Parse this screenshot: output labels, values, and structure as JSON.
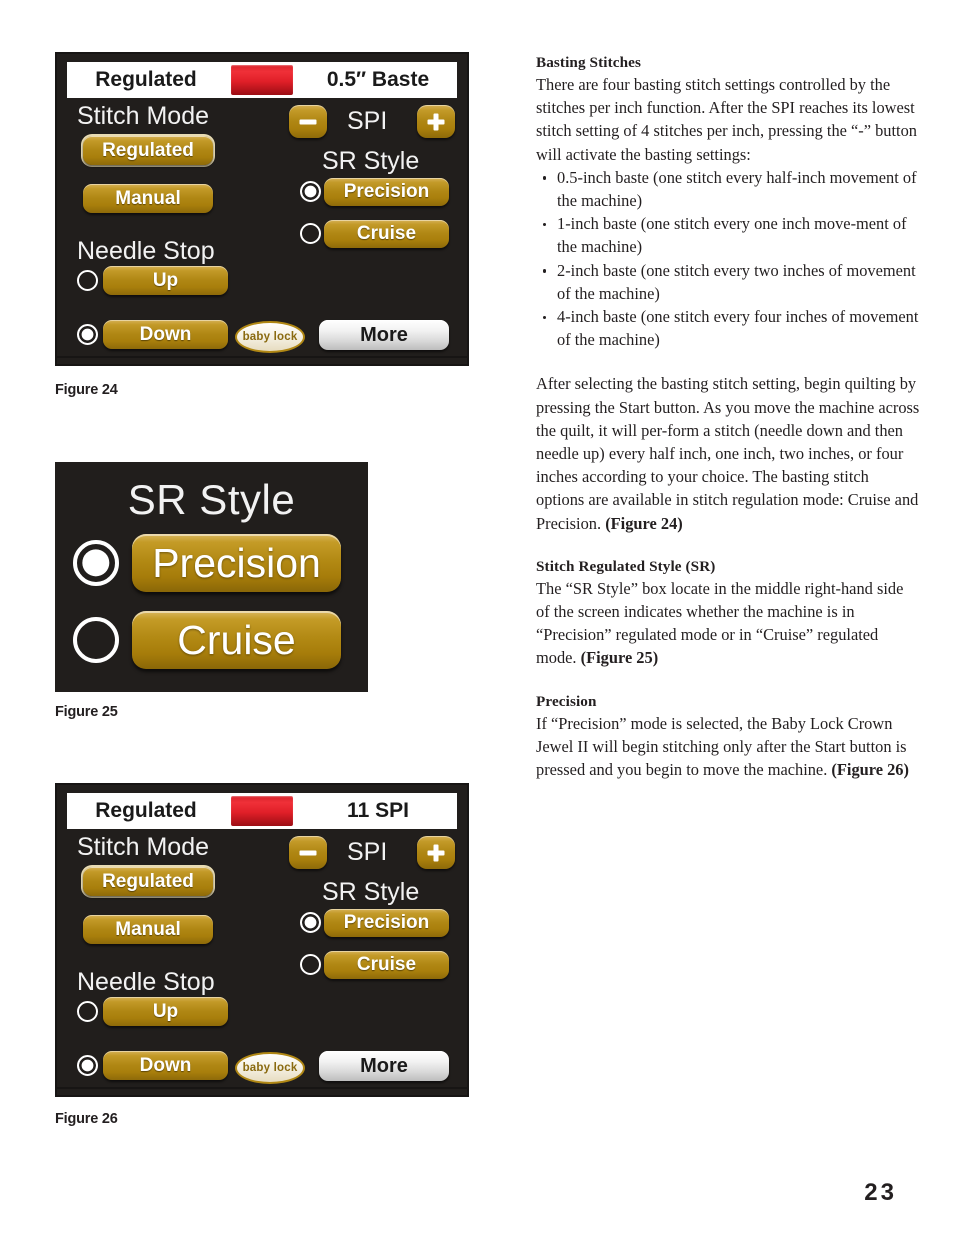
{
  "page": {
    "number": "23"
  },
  "figures": {
    "fig24": {
      "caption": "Figure 24",
      "statusbar": {
        "left": "Regulated",
        "right": "0.5″ Baste",
        "led_color": "#e01f28"
      },
      "stitch_mode_label": "Stitch Mode",
      "stitch_mode_options": [
        {
          "label": "Regulated",
          "selected": true
        },
        {
          "label": "Manual",
          "selected": false
        }
      ],
      "needle_stop_label": "Needle Stop",
      "needle_stop_options": [
        {
          "label": "Up",
          "selected": false
        },
        {
          "label": "Down",
          "selected": true
        }
      ],
      "spi_label": "SPI",
      "spi_minus": "−",
      "spi_plus": "+",
      "sr_style_label": "SR Style",
      "sr_style_options": [
        {
          "label": "Precision",
          "selected": true
        },
        {
          "label": "Cruise",
          "selected": false
        }
      ],
      "brand_logo": "baby lock",
      "more_label": "More"
    },
    "fig25": {
      "caption": "Figure 25",
      "title": "SR Style",
      "options": [
        {
          "label": "Precision",
          "selected": true
        },
        {
          "label": "Cruise",
          "selected": false
        }
      ]
    },
    "fig26": {
      "caption": "Figure 26",
      "statusbar": {
        "left": "Regulated",
        "right": "11 SPI",
        "led_color": "#e01f28"
      },
      "stitch_mode_label": "Stitch Mode",
      "stitch_mode_options": [
        {
          "label": "Regulated",
          "selected": true
        },
        {
          "label": "Manual",
          "selected": false
        }
      ],
      "needle_stop_label": "Needle Stop",
      "needle_stop_options": [
        {
          "label": "Up",
          "selected": false
        },
        {
          "label": "Down",
          "selected": true
        }
      ],
      "spi_label": "SPI",
      "spi_minus": "−",
      "spi_plus": "+",
      "sr_style_label": "SR Style",
      "sr_style_options": [
        {
          "label": "Precision",
          "selected": true
        },
        {
          "label": "Cruise",
          "selected": false
        }
      ],
      "brand_logo": "baby lock",
      "more_label": "More"
    }
  },
  "content": {
    "basting": {
      "heading": "Basting Stitches",
      "paragraph": "There are four basting stitch settings controlled by the stitches per inch function. After the SPI reaches its lowest stitch setting of 4 stitches per inch, pressing the “-” button will activate the basting settings:",
      "bullets": [
        "0.5-inch baste (one stitch every half-inch movement of the machine)",
        "1-inch baste (one stitch every one inch move-ment of the machine)",
        "2-inch baste (one stitch every two inches of movement of the machine)",
        "4-inch baste (one stitch every four inches of movement of the machine)"
      ]
    },
    "after_selecting": {
      "text": "After selecting the basting stitch setting, begin quilting by pressing the Start button. As you move the machine across the quilt, it will per-form a stitch (needle down and then needle up) every half inch, one inch, two inches, or four inches according to your choice. The basting stitch options are available in stitch regulation mode: Cruise and Precision. ",
      "figure_ref": "(Figure 24)"
    },
    "sr_section": {
      "heading": "Stitch Regulated Style (SR)",
      "text": "The “SR Style” box locate in the middle right-hand side of the screen indicates whether the machine is in “Precision” regulated mode or in “Cruise” regulated mode.  ",
      "figure_ref": "(Figure 25)"
    },
    "precision_section": {
      "heading": "Precision",
      "text": "If “Precision” mode is selected, the Baby Lock Crown Jewel II will begin stitching only after the Start button is pressed and you begin to move the machine.  ",
      "figure_ref": "(Figure 26)"
    }
  }
}
